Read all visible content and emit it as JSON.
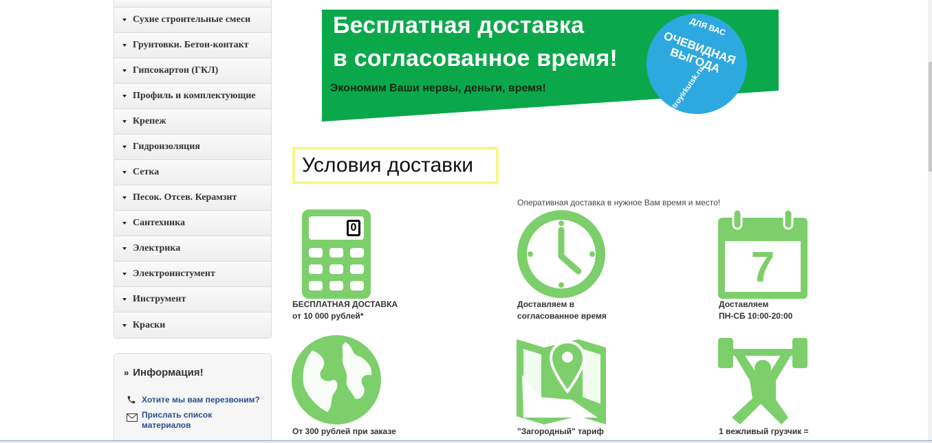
{
  "sidebar": {
    "categories": [
      "Сухие строительные смеси",
      "Грунтовки. Бетон-контакт",
      "Гипсокартон (ГКЛ)",
      "Профиль и комплектующие",
      "Крепеж",
      "Гидроизоляция",
      "Сетка",
      "Песок. Отсев. Керамзит",
      "Сантехника",
      "Электрика",
      "Электроинстумент",
      "Инструмент",
      "Краски"
    ],
    "info": {
      "title": "Информация!",
      "callback_link": "Хотите мы вам перезвоним?",
      "send_list_link": "Прислать список материалов"
    }
  },
  "banner": {
    "line1": "Бесплатная доставка",
    "line2": "в согласованное время!",
    "subline": "Экономим Ваши нервы, деньги, время!",
    "badge_top": "ДЛЯ ВАС",
    "badge_main": "ОЧЕВИДНАЯ ВЫГОДА",
    "badge_url": "stroyirkutsk.ru",
    "green": "#0aa84a",
    "blue": "#2ea9df"
  },
  "content": {
    "title": "Условия доставки",
    "lead": "Оперативная доставка в нужное Вам время и место!",
    "icon_color": "#7ccf6a",
    "calculator_display": "0",
    "calendar_day": "7",
    "features": [
      {
        "icon": "calculator-icon",
        "line1": "БЕСПЛАТНАЯ ДОСТАВКА",
        "line2": "от 10 000 рублей*"
      },
      {
        "icon": "clock-icon",
        "line1": "Доставляем в",
        "line2": "согласованное время"
      },
      {
        "icon": "calendar-icon",
        "line1": "Доставляем",
        "line2": "ПН-СБ 10:00-20:00"
      },
      {
        "icon": "globe-icon",
        "line1": "От 300 рублей при заказе",
        "line2": ""
      },
      {
        "icon": "map-pin-icon",
        "line1": "\"Загородный\" тариф",
        "line2": ""
      },
      {
        "icon": "weightlifter-icon",
        "line1": "1 вежливый грузчик =",
        "line2": ""
      }
    ]
  }
}
